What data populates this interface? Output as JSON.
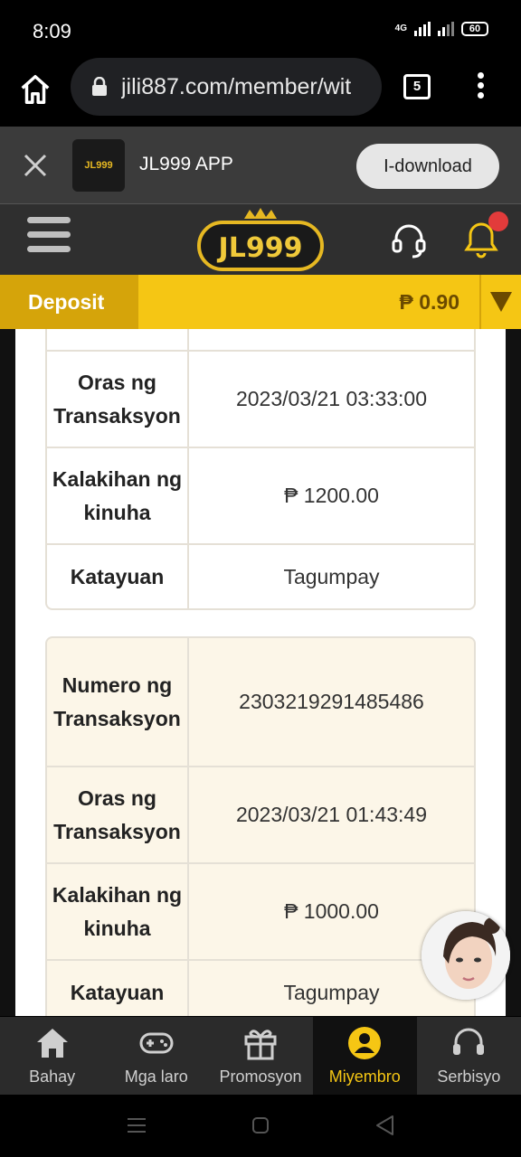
{
  "status_bar": {
    "time": "8:09",
    "network": "4G",
    "battery": "60"
  },
  "browser": {
    "url": "jili887.com/member/wit",
    "tab_count": "5"
  },
  "app_banner": {
    "app_name": "JL999 APP",
    "logo_text": "JL999",
    "download_label": "I-download"
  },
  "header": {
    "brand": "JL999"
  },
  "deposit_bar": {
    "deposit_label": "Deposit",
    "balance": "₱ 0.90"
  },
  "transactions": [
    {
      "rows": [
        {
          "label": "Oras ng Transaksyon",
          "value": "2023/03/21 03:33:00"
        },
        {
          "label": "Kalakihan ng kinuha",
          "value": "₱ 1200.00"
        },
        {
          "label": "Katayuan",
          "value": "Tagumpay"
        }
      ]
    },
    {
      "rows": [
        {
          "label": "Numero ng Transaksyon",
          "value": "2303219291485486"
        },
        {
          "label": "Oras ng Transaksyon",
          "value": "2023/03/21 01:43:49"
        },
        {
          "label": "Kalakihan ng kinuha",
          "value": "₱ 1000.00"
        },
        {
          "label": "Katayuan",
          "value": "Tagumpay"
        }
      ]
    }
  ],
  "bottom_nav": {
    "items": [
      {
        "label": "Bahay",
        "icon": "home-icon"
      },
      {
        "label": "Mga laro",
        "icon": "gamepad-icon"
      },
      {
        "label": "Promosyon",
        "icon": "gift-icon"
      },
      {
        "label": "Miyembro",
        "icon": "member-icon",
        "active": true
      },
      {
        "label": "Serbisyo",
        "icon": "headset-icon"
      }
    ]
  },
  "colors": {
    "accent": "#f5c614",
    "deposit_dark": "#d5a40a",
    "header_bg": "#2f2f2f",
    "card_cream": "#fcf6e8",
    "notification": "#e23b3b"
  }
}
